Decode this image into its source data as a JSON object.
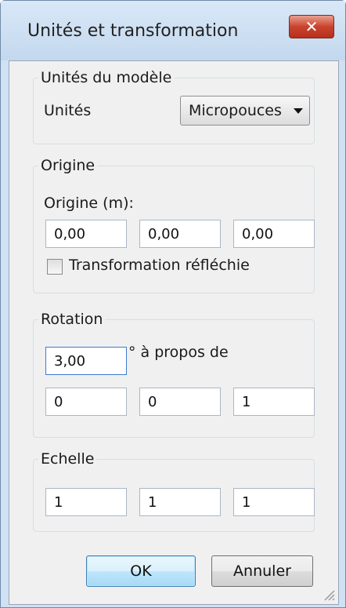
{
  "window": {
    "title": "Unités et transformation",
    "close_symbol": "✕"
  },
  "units_group": {
    "legend": "Unités du modèle",
    "label": "Unités",
    "selected": "Micropouces"
  },
  "origin_group": {
    "legend": "Origine",
    "label": "Origine (m):",
    "values": [
      "0,00",
      "0,00",
      "0,00"
    ],
    "checkbox_label": "Transformation réfléchie",
    "checkbox_checked": false
  },
  "rotation_group": {
    "legend": "Rotation",
    "angle": "3,00",
    "about_label": "° à propos de",
    "axis": [
      "0",
      "0",
      "1"
    ]
  },
  "scale_group": {
    "legend": "Echelle",
    "values": [
      "1",
      "1",
      "1"
    ]
  },
  "buttons": {
    "ok": "OK",
    "cancel": "Annuler"
  }
}
